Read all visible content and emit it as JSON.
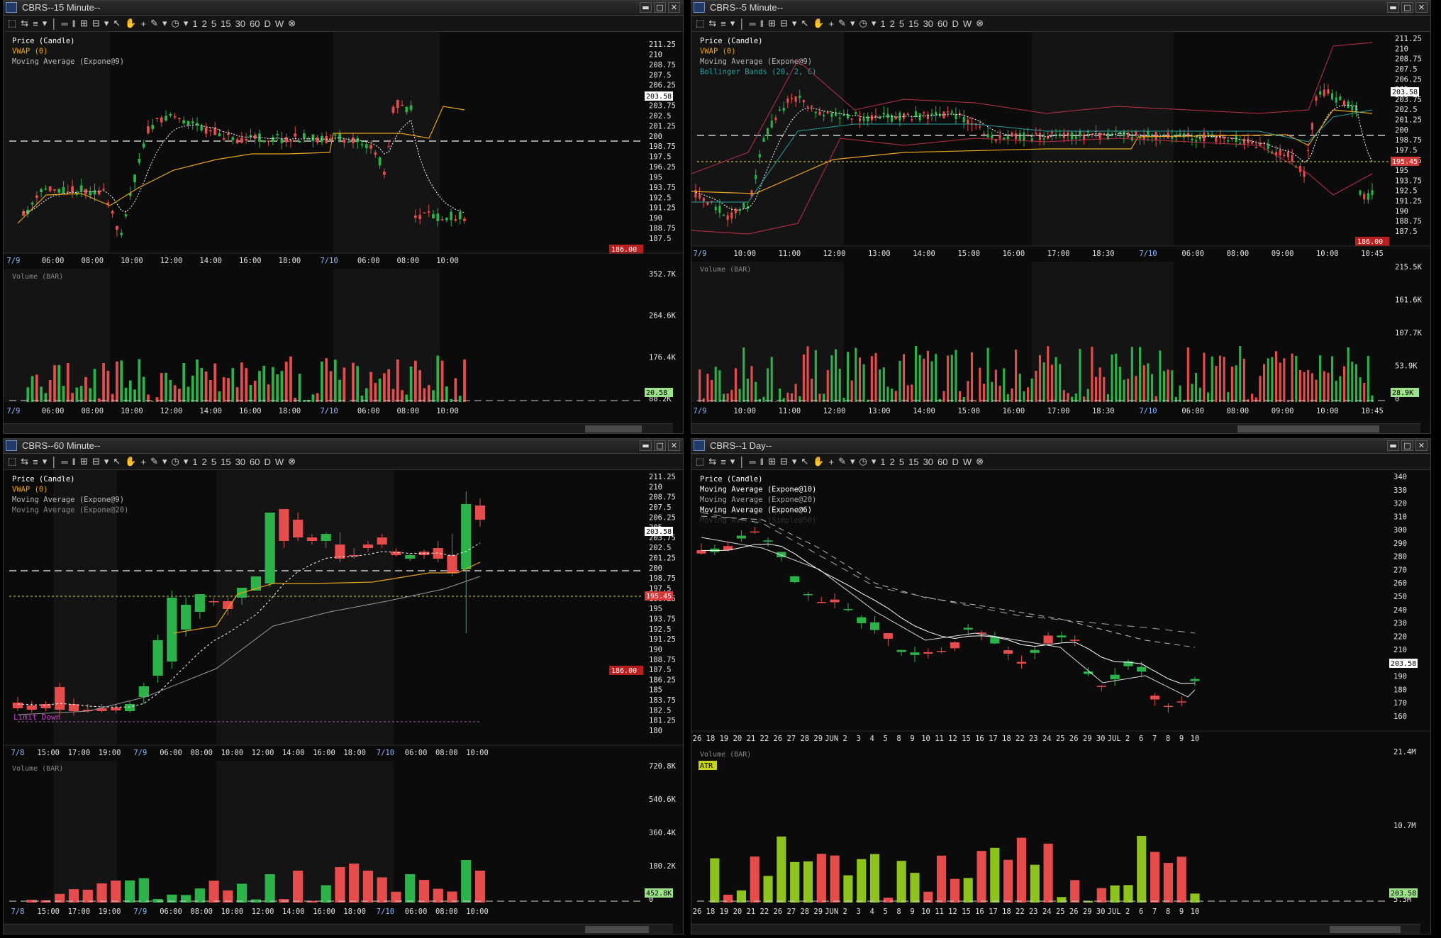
{
  "colors": {
    "up": "#2bb34a",
    "down": "#e74c4c",
    "vwap": "#e8a21b",
    "ema": "#ffffff",
    "bb": "#c0304a",
    "bid": "#e8e81b",
    "bg": "#0c0c0c",
    "grid": "#1a1a1a"
  },
  "toolbar": {
    "items": [
      "1",
      "2",
      "5",
      "15",
      "30",
      "60",
      "D",
      "W"
    ]
  },
  "panels": [
    {
      "id": "p15",
      "title": "CBRS--15 Minute--",
      "legend": [
        {
          "text": "Price (Candle)",
          "color": "#ffffff"
        },
        {
          "text": "VWAP (0)",
          "color": "#e8a21b"
        },
        {
          "text": "Moving Average (Expone@9)",
          "color": "#bbbbbb"
        }
      ],
      "price_labels": [
        "211.25",
        "210",
        "208.75",
        "207.5",
        "206.25",
        "205",
        "203.75",
        "202.5",
        "201.25",
        "200",
        "198.75",
        "197.5",
        "196.25",
        "195",
        "193.75",
        "192.5",
        "191.25",
        "190",
        "188.75",
        "187.5"
      ],
      "price_tag": "203.58",
      "bottom_tag": "186.00",
      "time_labels": [
        "7/9",
        "06:00",
        "08:00",
        "10:00",
        "12:00",
        "14:00",
        "16:00",
        "18:00",
        "7/10",
        "06:00",
        "08:00",
        "10:00"
      ],
      "volume_legend": "Volume (BAR)",
      "volume_labels": [
        "352.7K",
        "264.6K",
        "176.4K",
        "88.2K"
      ],
      "volume_tag": "20.58",
      "volume_time_labels": [
        "7/9",
        "06:00",
        "08:00",
        "10:00",
        "12:00",
        "14:00",
        "16:00",
        "18:00",
        "7/10",
        "06:00",
        "08:00",
        "10:00"
      ]
    },
    {
      "id": "p5",
      "title": "CBRS--5 Minute--",
      "legend": [
        {
          "text": "Price (Candle)",
          "color": "#ffffff"
        },
        {
          "text": "VWAP (0)",
          "color": "#e8a21b"
        },
        {
          "text": "Moving Average (Expone@9)",
          "color": "#bbbbbb"
        },
        {
          "text": "Bollinger Bands (20, 2, C)",
          "color": "#2aa0a0"
        }
      ],
      "price_labels": [
        "211.25",
        "210",
        "208.75",
        "207.5",
        "206.25",
        "205",
        "203.75",
        "202.5",
        "201.25",
        "200",
        "198.75",
        "197.5",
        "196.25",
        "195",
        "193.75",
        "192.5",
        "191.25",
        "190",
        "188.75",
        "187.5"
      ],
      "price_tag": "203.58",
      "bid_tag": "195.45",
      "bottom_tag": "186.00",
      "time_labels": [
        "7/9",
        "10:00",
        "11:00",
        "12:00",
        "13:00",
        "14:00",
        "15:00",
        "16:00",
        "17:00",
        "18:30",
        "7/10",
        "06:00",
        "08:00",
        "09:00",
        "10:00",
        "10:45"
      ],
      "volume_legend": "Volume (BAR)",
      "volume_labels": [
        "215.5K",
        "161.6K",
        "107.7K",
        "53.9K",
        "0"
      ],
      "volume_tag": "28.9K",
      "volume_time_labels": [
        "7/9",
        "10:00",
        "11:00",
        "12:00",
        "13:00",
        "14:00",
        "15:00",
        "16:00",
        "17:00",
        "18:30",
        "7/10",
        "06:00",
        "08:00",
        "09:00",
        "10:00",
        "10:45"
      ]
    },
    {
      "id": "p60",
      "title": "CBRS--60 Minute--",
      "legend": [
        {
          "text": "Price (Candle)",
          "color": "#ffffff"
        },
        {
          "text": "VWAP (0)",
          "color": "#e8a21b"
        },
        {
          "text": "Moving Average (Expone@9)",
          "color": "#bbbbbb"
        },
        {
          "text": "Moving Average (Expone@20)",
          "color": "#888888"
        }
      ],
      "price_labels": [
        "211.25",
        "210",
        "208.75",
        "207.5",
        "206.25",
        "205",
        "203.75",
        "202.5",
        "201.25",
        "200",
        "198.75",
        "197.5",
        "196.25",
        "195",
        "193.75",
        "192.5",
        "191.25",
        "190",
        "188.75",
        "187.5",
        "186.25",
        "185",
        "183.75",
        "182.5",
        "181.25",
        "180"
      ],
      "price_tag": "203.58",
      "bid_tag": "195.45",
      "bottom_tag": "186.00",
      "limit_label": "Limit Down",
      "time_labels": [
        "7/8",
        "15:00",
        "17:00",
        "19:00",
        "7/9",
        "06:00",
        "08:00",
        "10:00",
        "12:00",
        "14:00",
        "16:00",
        "18:00",
        "7/10",
        "06:00",
        "08:00",
        "10:00"
      ],
      "volume_legend": "Volume (BAR)",
      "volume_labels": [
        "720.8K",
        "540.6K",
        "360.4K",
        "180.2K",
        "0"
      ],
      "volume_tag": "452.8K",
      "volume_time_labels": [
        "7/8",
        "15:00",
        "17:00",
        "19:00",
        "7/9",
        "06:00",
        "08:00",
        "10:00",
        "12:00",
        "14:00",
        "16:00",
        "18:00",
        "7/10",
        "06:00",
        "08:00",
        "10:00"
      ]
    },
    {
      "id": "pD",
      "title": "CBRS--1 Day--",
      "legend": [
        {
          "text": "Price (Candle)",
          "color": "#ffffff"
        },
        {
          "text": "Moving Average (Expone@10)",
          "color": "#ffffff"
        },
        {
          "text": "Moving Average (Expone@20)",
          "color": "#aaaaaa"
        },
        {
          "text": "Moving Average (Expone@6)",
          "color": "#ffffff"
        },
        {
          "text": "Moving Average (Simple@50)",
          "color": "#333333"
        }
      ],
      "price_labels": [
        "340",
        "330",
        "320",
        "310",
        "300",
        "290",
        "280",
        "270",
        "260",
        "250",
        "240",
        "230",
        "220",
        "210",
        "200",
        "190",
        "180",
        "170",
        "160"
      ],
      "price_tag": "203.58",
      "time_labels": [
        "26",
        "18",
        "19",
        "20",
        "21",
        "22",
        "26",
        "27",
        "28",
        "29",
        "JUN",
        "2",
        "3",
        "4",
        "5",
        "8",
        "9",
        "10",
        "11",
        "12",
        "15",
        "16",
        "17",
        "18",
        "22",
        "23",
        "24",
        "25",
        "26",
        "29",
        "30",
        "JUL",
        "2",
        "6",
        "7",
        "8",
        "9",
        "10"
      ],
      "volume_legend": "Volume (BAR)",
      "atr_label": "ATR",
      "volume_labels": [
        "21.4M",
        "10.7M",
        "5.3M"
      ],
      "volume_tag": "203.58"
    }
  ]
}
